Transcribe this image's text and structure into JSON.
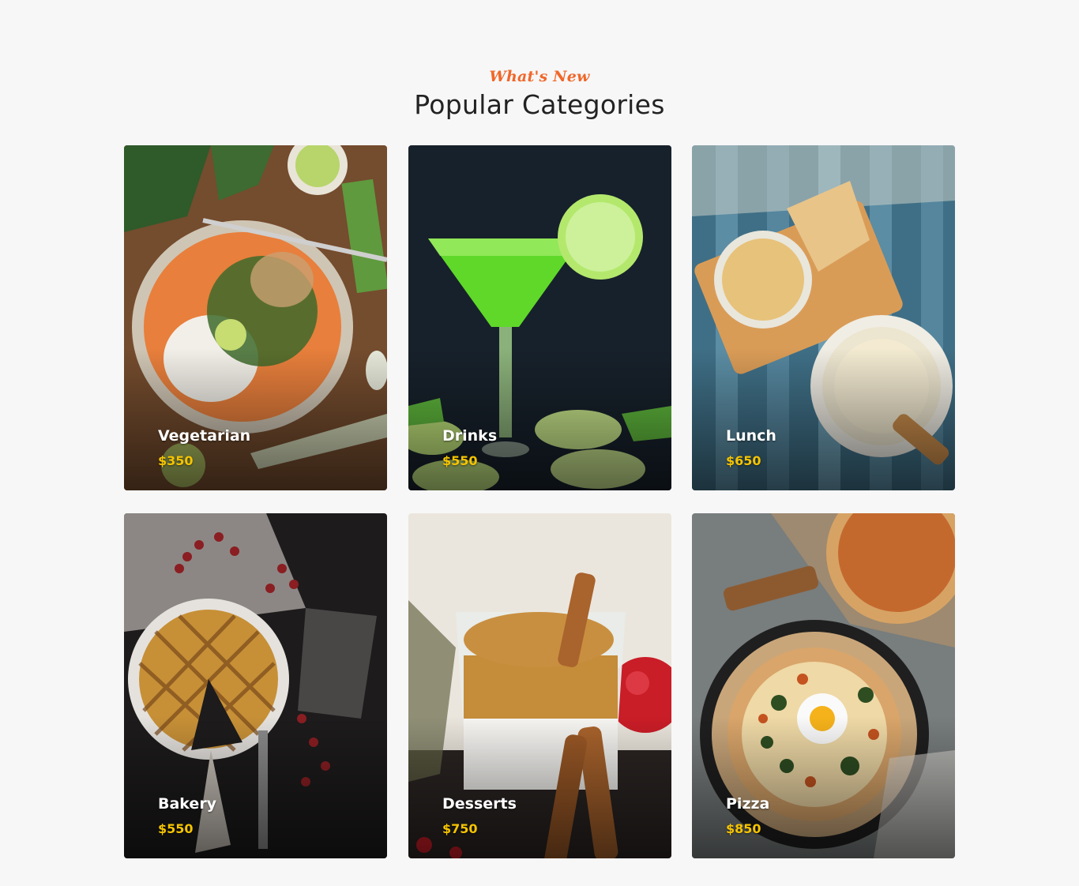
{
  "section": {
    "eyebrow": "What's New",
    "title": "Popular Categories"
  },
  "categories": [
    {
      "name": "Vegetarian",
      "price": "$350",
      "image": "vegetarian-curry-plate-image"
    },
    {
      "name": "Drinks",
      "price": "$550",
      "image": "green-cocktail-glass-image"
    },
    {
      "name": "Lunch",
      "price": "$650",
      "image": "lunch-soup-bowls-image"
    },
    {
      "name": "Bakery",
      "price": "$550",
      "image": "lattice-pie-image"
    },
    {
      "name": "Desserts",
      "price": "$750",
      "image": "dessert-jar-cinnamon-image"
    },
    {
      "name": "Pizza",
      "price": "$850",
      "image": "pizza-skillet-image"
    }
  ],
  "colors": {
    "background": "#f7f7f7",
    "eyebrow": "#f0672a",
    "title": "#222222",
    "price": "#f5c400",
    "card_name": "#ffffff"
  }
}
